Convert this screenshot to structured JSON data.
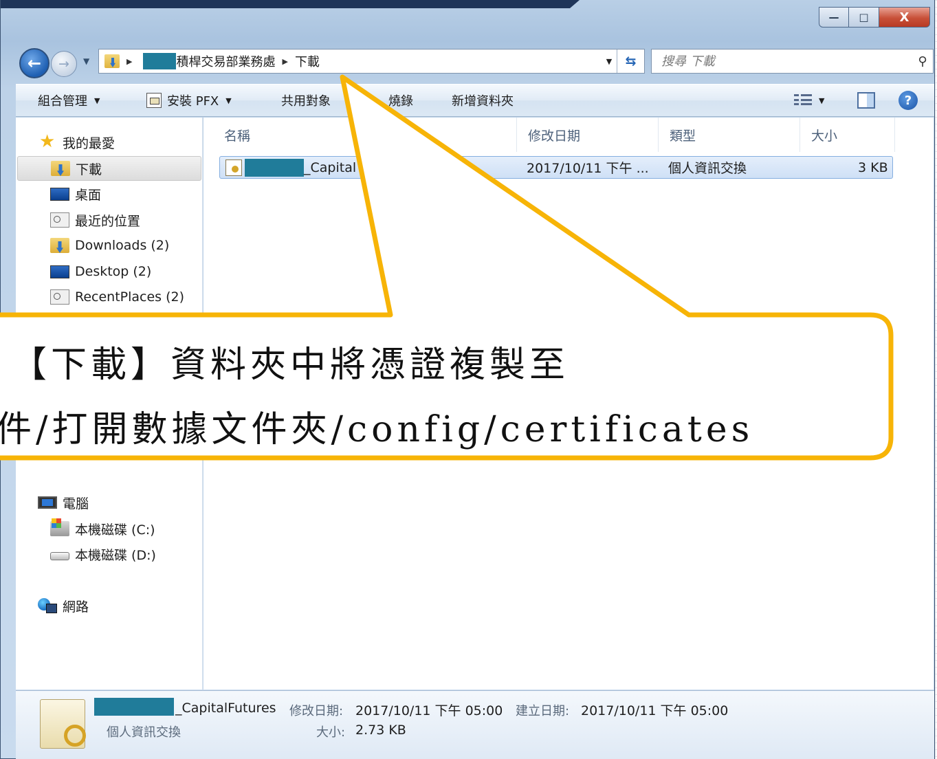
{
  "window": {
    "minimize_glyph": "—",
    "maximize_glyph": "□",
    "close_glyph": "X"
  },
  "address": {
    "segments": [
      "積桿交易部業務處",
      "下載"
    ],
    "search_placeholder": "搜尋 下載"
  },
  "commands": {
    "organize": "組合管理",
    "install_pfx": "安裝 PFX",
    "share_with": "共用對象",
    "burn": "燒錄",
    "new_folder": "新增資料夾"
  },
  "nav": {
    "favorites": "我的最愛",
    "downloads": "下載",
    "desktop": "桌面",
    "recent": "最近的位置",
    "downloads_en": "Downloads (2)",
    "desktop_en": "Desktop (2)",
    "recent_en": "RecentPlaces (2)",
    "computer": "電腦",
    "drive_c": "本機磁碟 (C:)",
    "drive_d": "本機磁碟 (D:)",
    "network": "網路"
  },
  "columns": {
    "name": "名稱",
    "modified": "修改日期",
    "type": "類型",
    "size": "大小"
  },
  "files": [
    {
      "name": "_Capital",
      "modified": "2017/10/11 下午 ...",
      "type": "個人資訊交換",
      "size": "3 KB"
    }
  ],
  "details": {
    "name": "_CapitalFutures",
    "type": "個人資訊交換",
    "modified_label": "修改日期:",
    "modified_value": "2017/10/11 下午 05:00",
    "created_label": "建立日期:",
    "created_value": "2017/10/11 下午 05:00",
    "size_label": "大小:",
    "size_value": "2.73 KB"
  },
  "callout": {
    "line1": "【下載】資料夾中將憑證複製至",
    "line2": "件/打開數據文件夾/config/certificates",
    "border_color": "#f7b407"
  }
}
